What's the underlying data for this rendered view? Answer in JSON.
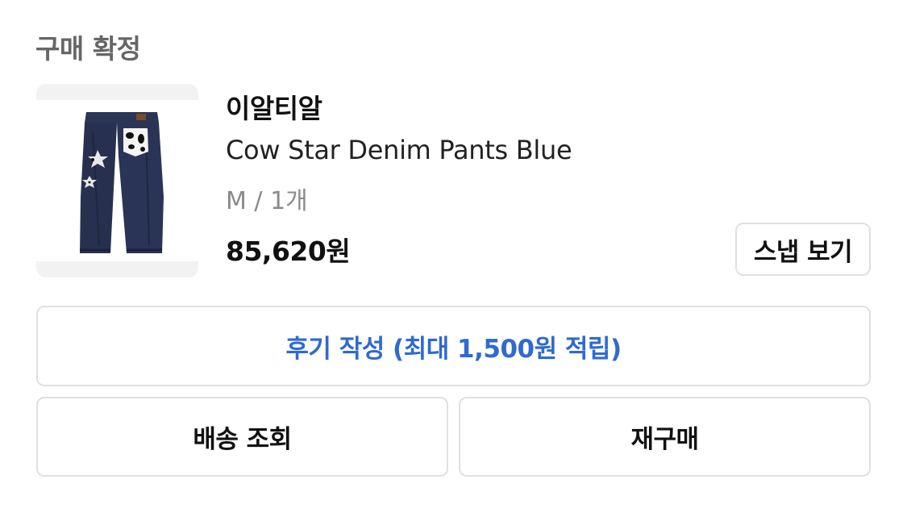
{
  "order": {
    "status_label": "구매 확정"
  },
  "product": {
    "brand": "이알티알",
    "name": "Cow Star Denim Pants Blue",
    "option": "M / 1개",
    "price": "85,620원",
    "image_icon": "denim-pants-thumbnail"
  },
  "actions": {
    "snap_label": "스냅 보기",
    "review_label": "후기 작성 (최대 1,500원 적립)",
    "delivery_label": "배송 조회",
    "rebuy_label": "재구매"
  },
  "colors": {
    "review_accent": "#2e6ad1",
    "status_gray": "#666666",
    "option_gray": "#8a8a8a",
    "border": "#e0e0e0"
  }
}
